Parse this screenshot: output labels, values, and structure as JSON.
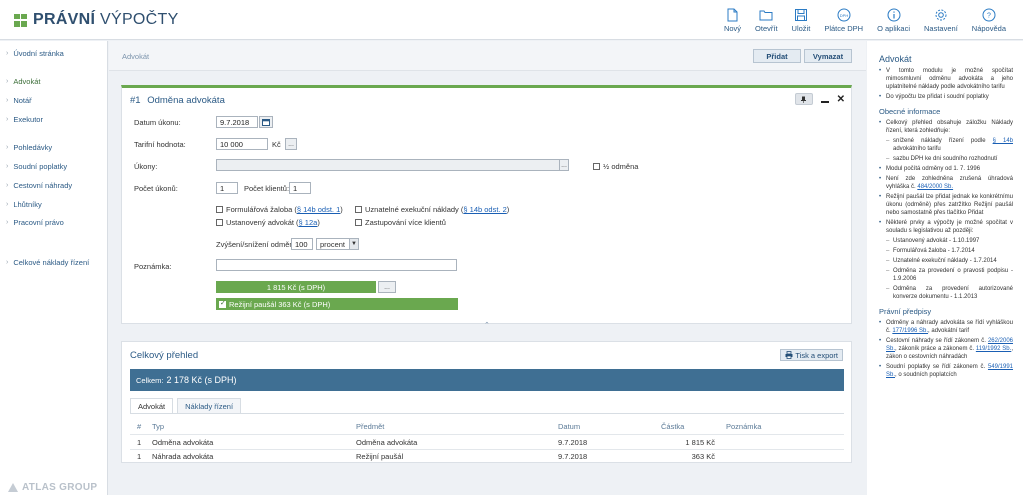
{
  "app": {
    "title_bold": "PRÁVNÍ",
    "title_rest": "VÝPOČTY",
    "brand_color": "#6aa84f",
    "footer_brand": "ATLAS GROUP"
  },
  "toolbar": [
    {
      "name": "new",
      "label": "Nový",
      "icon": "file-icon"
    },
    {
      "name": "open",
      "label": "Otevřít",
      "icon": "folder-icon"
    },
    {
      "name": "save",
      "label": "Uložit",
      "icon": "save-icon"
    },
    {
      "name": "vat",
      "label": "Plátce DPH",
      "icon": "vat-icon"
    },
    {
      "name": "about",
      "label": "O aplikaci",
      "icon": "info-icon"
    },
    {
      "name": "settings",
      "label": "Nastavení",
      "icon": "gear-icon"
    },
    {
      "name": "help",
      "label": "Nápověda",
      "icon": "help-icon"
    }
  ],
  "sidebar": [
    {
      "label": "Úvodní stránka"
    },
    {
      "label": "Advokát",
      "active": true
    },
    {
      "label": "Notář"
    },
    {
      "label": "Exekutor"
    },
    {
      "label": "Pohledávky"
    },
    {
      "label": "Soudní poplatky"
    },
    {
      "label": "Cestovní náhrady"
    },
    {
      "label": "Lhůtníky"
    },
    {
      "label": "Pracovní právo"
    },
    {
      "label": "Celkové náklady řízení"
    }
  ],
  "main": {
    "bar_title": "Advokát",
    "add_label": "Přidat",
    "reset_label": "Vymazat",
    "card": {
      "number": "#1",
      "title": "Odměna advokáta",
      "date_label": "Datum úkonu:",
      "date_value": "9.7.2018",
      "tariff_label": "Tarifní hodnota:",
      "tariff_value": "10 000",
      "currency": "Kč",
      "acts_label": "Úkony:",
      "half_label": "½ odměna",
      "count_label": "Počet úkonů:",
      "count_value": "1",
      "clients_label": "Počet klientů:",
      "clients_value": "1",
      "chk_form_pre": "Formulářová žaloba (",
      "chk_form_link": "§ 14b odst. 1",
      "chk_form_post": ")",
      "chk_appointed_pre": "Ustanovený advokát (",
      "chk_appointed_link": "§ 12a",
      "chk_appointed_post": ")",
      "chk_exec_pre": "Uznatelné exekuční náklady (",
      "chk_exec_link": "§ 14b odst. 2",
      "chk_exec_post": ")",
      "chk_multi": "Zastupování více klientů",
      "adjust_label": "Zvýšení/snížení odměny",
      "adjust_value": "100",
      "adjust_unit": "procent",
      "note_label": "Poznámka:",
      "result_fee": "1 815 Kč (s DPH)",
      "result_flat": "Režijní paušál 363 Kč (s DPH)",
      "ellipsis": "..."
    }
  },
  "overview": {
    "title": "Celkový přehled",
    "print_label": "Tisk a export",
    "total_prefix": "Celkem:",
    "total_value": "2 178 Kč (s DPH)",
    "tabs": [
      "Advokát",
      "Náklady řízení"
    ],
    "headers": [
      "#",
      "Typ",
      "Předmět",
      "Datum",
      "Částka",
      "Poznámka"
    ],
    "rows": [
      {
        "n": "1",
        "type": "Odměna advokáta",
        "subject": "Odměna advokáta",
        "date": "9.7.2018",
        "amount": "1 815 Kč",
        "note": ""
      },
      {
        "n": "1",
        "type": "Náhrada advokáta",
        "subject": "Režijní paušál",
        "date": "9.7.2018",
        "amount": "363 Kč",
        "note": ""
      }
    ]
  },
  "help": {
    "title": "Advokát",
    "intro": [
      "V tomto modulu je možné spočítat mimosmluvní odměnu advokáta a jeho uplatnitelné náklady podle advokátního tarifu",
      "Do výpočtu lze přidat i soudní poplatky"
    ],
    "general_title": "Obecné informace",
    "general_1": "Celkový přehled obsahuje záložku Náklady řízení, která zohledňuje:",
    "general_1_sub1_pre": "snížené náklady řízení podle ",
    "general_1_sub1_link": "§ 14b",
    "general_1_sub1_post": " advokátního tarifu",
    "general_1_sub2": "sazbu DPH ke dni soudního rozhodnutí",
    "general_2": "Modul počítá odměny od 1. 7. 1996",
    "general_3_pre": "Není zde zohledněna zrušená úhradová vyhláška č. ",
    "general_3_link": "484/2000 Sb.",
    "general_4": "Režijní paušál lze přidat jednak ke konkrétnímu úkonu (odměně) přes zatržítko Režijní paušál nebo samostatně přes tlačítko Přidat",
    "general_5": "Některé prvky a výpočty je možné spočítat v souladu s legislativou až později:",
    "general_5_subs": [
      "Ustanovený advokát - 1.10.1997",
      "Formulářová žaloba - 1.7.2014",
      "Uznatelné exekuční náklady - 1.7.2014",
      "Odměna za provedení o pravosti podpisu - 1.9.2006",
      "Odměna za provedení autorizované konverze dokumentu - 1.1.2013"
    ],
    "law_title": "Právní předpisy",
    "law_1_pre": "Odměny a náhrady advokáta se řídí vyhláškou č. ",
    "law_1_link": "177/1996 Sb.",
    "law_1_post": ", advokátní tarif",
    "law_2_pre": "Cestovní náhrady se řídí zákonem č. ",
    "law_2_link1": "262/2006 Sb.",
    "law_2_mid": ", zákoník práce a zákonem č. ",
    "law_2_link2": "119/1992 Sb.",
    "law_2_post": ", zákon o cestovních náhradách",
    "law_3_pre": "Soudní poplatky se řídí zákonem č. ",
    "law_3_link": "549/1991 Sb.",
    "law_3_post": ", o soudních poplatcích"
  }
}
